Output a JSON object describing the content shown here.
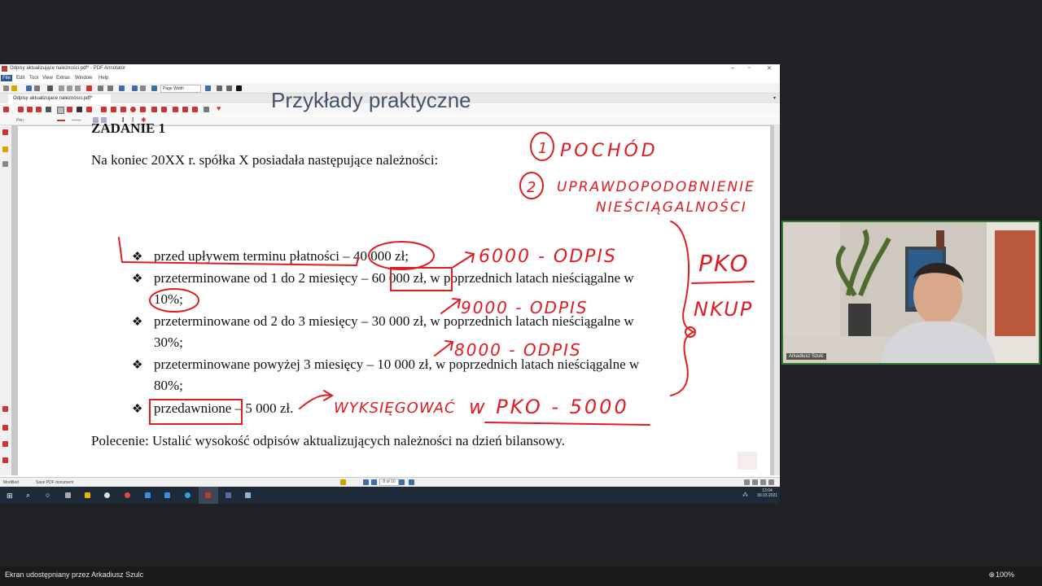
{
  "window": {
    "title": "Odpisy aktualizujące należności.pdf* - PDF Annotator",
    "menu": [
      "File",
      "Edit",
      "Tool",
      "View",
      "Extras",
      "Window",
      "Help"
    ],
    "zoom_select": "Page Width",
    "tab": "Odpisy aktualizujace naleznosci.pdf*",
    "pen_label": "Pen"
  },
  "slide": {
    "title": "Przykłady praktyczne",
    "task": "ZADANIE 1",
    "intro": "Na koniec 20XX r. spółka X posiadała następujące należności:",
    "bullet_char": "❖",
    "items": [
      {
        "line1": "przed upływem terminu płatności – 40 000 zł;",
        "line2": ""
      },
      {
        "line1": "przeterminowane od 1 do 2 miesięcy – 60 000 zł, w poprzednich latach nieściągalne w",
        "line2": "10%;"
      },
      {
        "line1": "przeterminowane od 2 do 3 miesięcy – 30 000 zł, w poprzednich latach nieściągalne w",
        "line2": "30%;"
      },
      {
        "line1": "przeterminowane powyżej 3 miesięcy – 10 000 zł, w poprzednich latach nieściągalne w",
        "line2": "80%;"
      },
      {
        "line1": "przedawnione – 5 000 zł.",
        "line2": ""
      }
    ],
    "instruction": "Polecenie: Ustalić wysokość odpisów aktualizujących należności na dzień bilansowy."
  },
  "annotations": {
    "n1": "1",
    "w1": "POCHÓD",
    "n2": "2",
    "w2a": "UPRAWDOPODOBNIENIE",
    "w2b": "NIEŚCIĄGALNOŚCI",
    "odpis1": "6000 - ODPIS",
    "odpis2": "9000 - ODPIS",
    "odpis3": "8000 - ODPIS",
    "wyksieg": "WYKSIĘGOWAĆ",
    "pko": "w PKO - 5000",
    "side1": "PKO",
    "side2": "NKUP",
    "color": "#e11b22"
  },
  "status": {
    "left": "Modified",
    "mid": "Save PDF document",
    "page": "8 of 10"
  },
  "clock": {
    "time": "13:04",
    "date": "30.03.2021"
  },
  "webcam": {
    "name": "Arkadiusz Szulc"
  },
  "bottom": {
    "share": "Ekran udostępniany przez Arkadiusz Szulc",
    "zoom": "100%"
  }
}
